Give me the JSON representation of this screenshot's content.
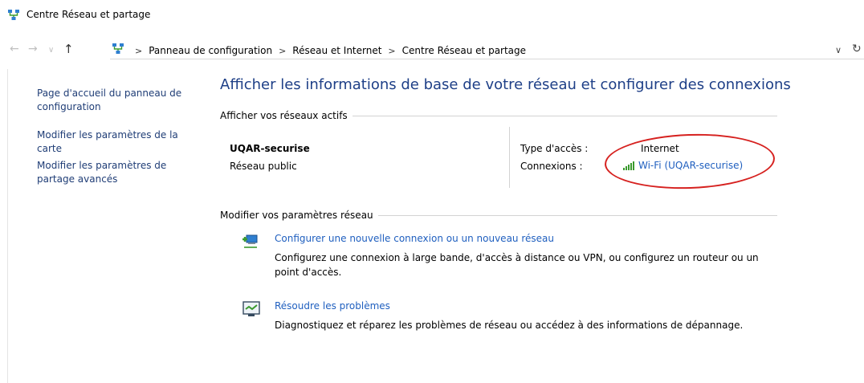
{
  "window": {
    "title": "Centre Réseau et partage"
  },
  "address": {
    "crumbs": [
      "Panneau de configuration",
      "Réseau et Internet",
      "Centre Réseau et partage"
    ]
  },
  "sidebar": {
    "items": [
      {
        "label": "Page d'accueil du panneau de configuration"
      },
      {
        "label": "Modifier les paramètres de la carte"
      },
      {
        "label": "Modifier les paramètres de partage avancés"
      }
    ]
  },
  "main": {
    "title": "Afficher les informations de base de votre réseau et configurer des connexions",
    "active_section": "Afficher vos réseaux actifs",
    "network": {
      "name": "UQAR-securise",
      "profile": "Réseau public",
      "access_type_label": "Type d'accès :",
      "access_type_value": "Internet",
      "connections_label": "Connexions :",
      "connection_value": "Wi-Fi (UQAR-securise)"
    },
    "settings_section": "Modifier vos paramètres réseau",
    "tasks": [
      {
        "link": "Configurer une nouvelle connexion ou un nouveau réseau",
        "desc": "Configurez une connexion à large bande, d'accès à distance ou VPN, ou configurez un routeur ou un point d'accès."
      },
      {
        "link": "Résoudre les problèmes",
        "desc": "Diagnostiquez et réparez les problèmes de réseau ou accédez à des informations de dépannage."
      }
    ]
  },
  "colors": {
    "link": "#1f5fbf",
    "title": "#1e3f87",
    "annotation": "#d6211f",
    "signal": "#3a9a2e"
  }
}
